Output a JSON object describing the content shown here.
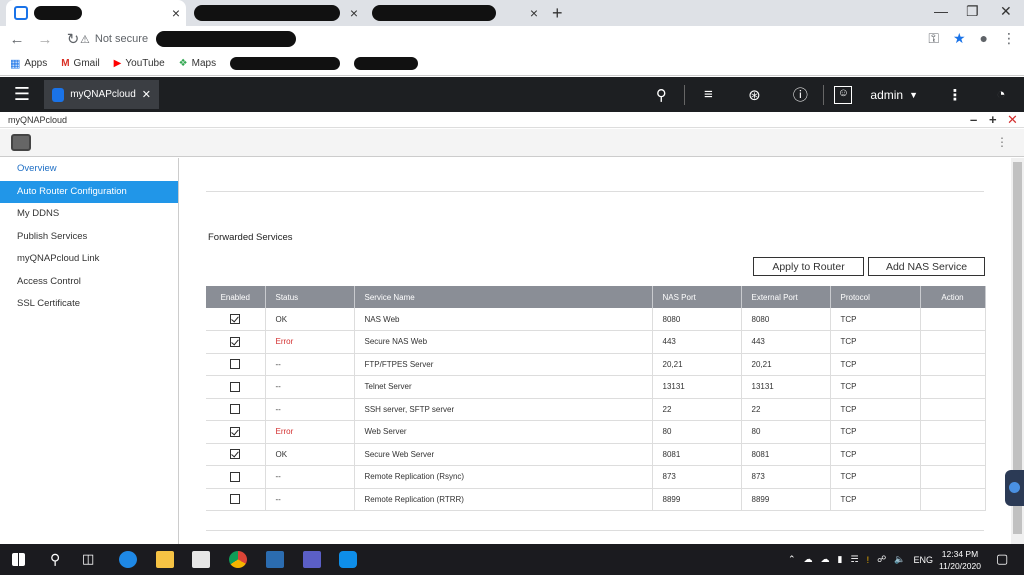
{
  "browser": {
    "omnibox_status": "Not secure",
    "bookmarks": [
      {
        "label": "Apps",
        "icon": "apps-grid-icon",
        "color": "#1a73e8"
      },
      {
        "label": "Gmail",
        "icon": "gmail-icon",
        "color": "#d93025"
      },
      {
        "label": "YouTube",
        "icon": "youtube-icon",
        "color": "#ff0000"
      },
      {
        "label": "Maps",
        "icon": "maps-icon",
        "color": "#34a853"
      }
    ],
    "new_tab_symbol": "+",
    "close_symbol": "×"
  },
  "qts": {
    "app_tab_label": "myQNAPcloud",
    "user": "admin",
    "window_title": "myQNAPcloud"
  },
  "sidebar": {
    "items": [
      {
        "label": "Overview"
      },
      {
        "label": "Auto Router Configuration"
      },
      {
        "label": "My DDNS"
      },
      {
        "label": "Publish Services"
      },
      {
        "label": "myQNAPcloud Link"
      },
      {
        "label": "Access Control"
      },
      {
        "label": "SSL Certificate"
      }
    ]
  },
  "main": {
    "section_title": "Forwarded Services",
    "apply_button": "Apply to Router",
    "add_button": "Add NAS Service",
    "columns": [
      "Enabled",
      "Status",
      "Service Name",
      "NAS Port",
      "External Port",
      "Protocol",
      "Action"
    ],
    "rows": [
      {
        "enabled": true,
        "status": "OK",
        "service": "NAS Web",
        "nas_port": "8080",
        "ext_port": "8080",
        "protocol": "TCP"
      },
      {
        "enabled": true,
        "status": "Error",
        "service": "Secure NAS Web",
        "nas_port": "443",
        "ext_port": "443",
        "protocol": "TCP"
      },
      {
        "enabled": false,
        "status": "--",
        "service": "FTP/FTPES Server",
        "nas_port": "20,21",
        "ext_port": "20,21",
        "protocol": "TCP"
      },
      {
        "enabled": false,
        "status": "--",
        "service": "Telnet Server",
        "nas_port": "13131",
        "ext_port": "13131",
        "protocol": "TCP"
      },
      {
        "enabled": false,
        "status": "--",
        "service": "SSH server, SFTP server",
        "nas_port": "22",
        "ext_port": "22",
        "protocol": "TCP"
      },
      {
        "enabled": true,
        "status": "Error",
        "service": "Web Server",
        "nas_port": "80",
        "ext_port": "80",
        "protocol": "TCP"
      },
      {
        "enabled": true,
        "status": "OK",
        "service": "Secure Web Server",
        "nas_port": "8081",
        "ext_port": "8081",
        "protocol": "TCP"
      },
      {
        "enabled": false,
        "status": "--",
        "service": "Remote Replication (Rsync)",
        "nas_port": "873",
        "ext_port": "873",
        "protocol": "TCP"
      },
      {
        "enabled": false,
        "status": "--",
        "service": "Remote Replication (RTRR)",
        "nas_port": "8899",
        "ext_port": "8899",
        "protocol": "TCP"
      }
    ]
  },
  "taskbar": {
    "language": "ENG",
    "time": "12:34 PM",
    "date": "11/20/2020"
  },
  "colors": {
    "accent": "#2196e8",
    "error": "#d32f2f",
    "header_bg": "#1d1f22",
    "table_header": "#8a8e96"
  }
}
